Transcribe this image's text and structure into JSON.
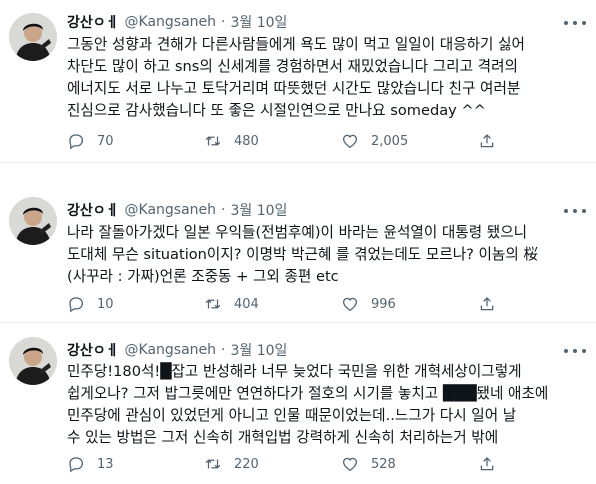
{
  "tweets": [
    {
      "name": "강산ㅇㅔ",
      "handle": "@Kangsaneh",
      "separator": "·",
      "date": "3월 10일",
      "lines": [
        "그동안 성향과 견해가 다른사람들에게 욕도 많이 먹고 일일이 대응하기 싫어",
        "차단도 많이 하고 sns의 신세계를 경험하면서  재밌었습니다 그리고 격려의",
        "에너지도 서로 나누고 토닥거리며 따뜻했던 시간도 많았습니다 친구 여러분",
        "진심으로 감사했습니다 또 좋은 시절인연으로 만나요  someday ^^"
      ],
      "replies": "70",
      "retweets": "480",
      "likes": "2,005"
    },
    {
      "name": "강산ㅇㅔ",
      "handle": "@Kangsaneh",
      "separator": "·",
      "date": "3월 10일",
      "lines": [
        "나라 잘돌아가겠다 일본 우익들(전범후예)이 바라는 윤석열이 대통령 됐으니",
        "도대체 무슨 situation이지? 이명박 박근혜 를 겪었는데도 모르나? 이놈의 桜",
        "(사꾸라 : 가짜)언론 조중동 + 그외 종편 etc"
      ],
      "replies": "10",
      "retweets": "404",
      "likes": "996"
    },
    {
      "name": "강산ㅇㅔ",
      "handle": "@Kangsaneh",
      "separator": "·",
      "date": "3월 10일",
      "lines": [
        "민주당!180석!█잡고 반성해라 너무 늦었다 국민을 위한 개혁세상이그렇게",
        "쉽게오나? 그저 밥그릇에만 연연하다가 절호의 시기를 놓치고 ███됐네 애초에",
        "민주당에 관심이 있었던게 아니고 인물 때문이었는데..느그가 다시 일어 날",
        "수 있는 방법은 그저 신속히 개혁입법 강력하게 신속히 처리하는거 밖에"
      ],
      "replies": "13",
      "retweets": "220",
      "likes": "528"
    }
  ],
  "colors": {
    "text": "#0f1419",
    "secondary": "#536471",
    "divider": "#eff3f4"
  },
  "icons": [
    "avatar",
    "more-icon",
    "reply-icon",
    "retweet-icon",
    "like-icon",
    "share-icon"
  ]
}
